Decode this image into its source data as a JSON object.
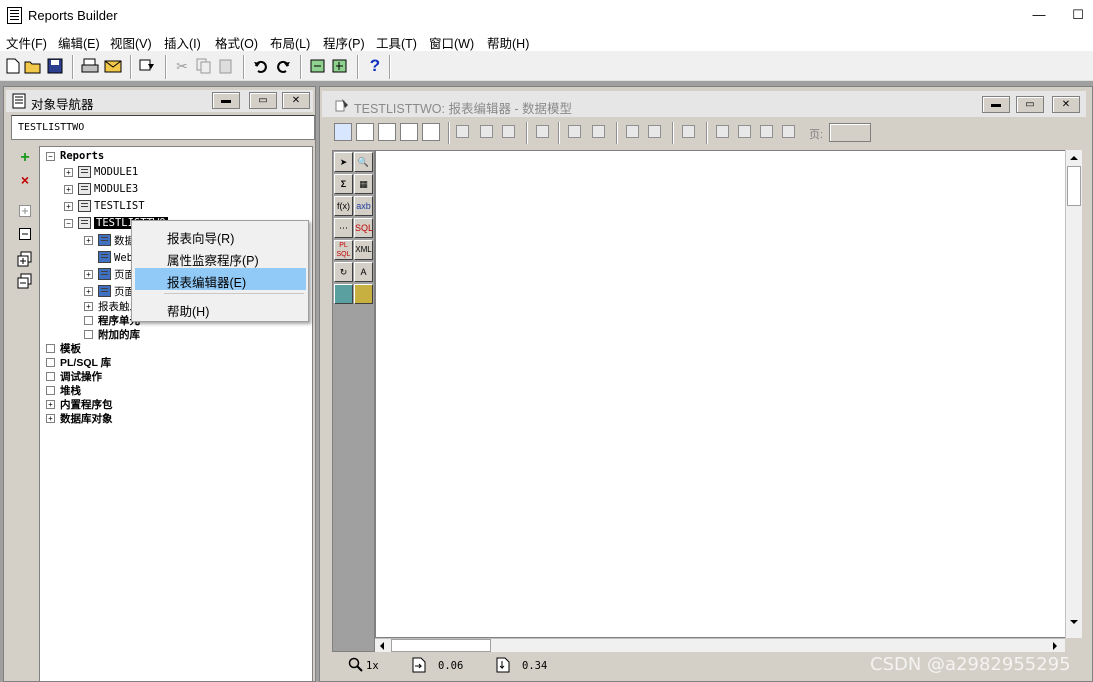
{
  "window": {
    "title": "Reports Builder",
    "minimize": "—",
    "maximize": "☐"
  },
  "menu": [
    "文件(F)",
    "编辑(E)",
    "视图(V)",
    "插入(I)",
    "格式(O)",
    "布局(L)",
    "程序(P)",
    "工具(T)",
    "窗口(W)",
    "帮助(H)"
  ],
  "toolbar": {
    "help": "?"
  },
  "navigator": {
    "title": "对象导航器",
    "find_value": "TESTLISTTWO",
    "tools": {
      "create": "+",
      "delete": "×"
    },
    "tree": {
      "reports": "Reports",
      "module1": "MODULE1",
      "module3": "MODULE3",
      "testlist": "TESTLIST",
      "testlisttwo": "TESTLISTTWO",
      "child_data": "数据模型",
      "child_web": "Web 源",
      "child_layout": "页面布局",
      "child_param": "页面参数",
      "child_triggers": "报表触发器",
      "child_units": "程序单元",
      "child_libs": "附加的库",
      "templates": "模板",
      "plsql": "PL/SQL 库",
      "debug": "调试操作",
      "stack": "堆栈",
      "builtin": "内置程序包",
      "dbobjects": "数据库对象"
    }
  },
  "context_menu": {
    "items": [
      "报表向导(R)",
      "属性监察程序(P)",
      "报表编辑器(E)",
      "帮助(H)"
    ],
    "highlighted": "报表编辑器(E)"
  },
  "editor": {
    "title": "TESTLISTTWO: 报表编辑器 - 数据模型",
    "page_label": "页:",
    "page_value": "",
    "status": {
      "zoom": "1x",
      "x": "0.06",
      "y": "0.34"
    },
    "palette": {
      "formula": "f(x)",
      "summary": "Σ",
      "placeholder": "axb",
      "sql": "SQL",
      "plsql": "PL SQL",
      "xml": "XML"
    }
  },
  "watermark": "CSDN @a2982955295",
  "colors": {
    "highlight": "#91c9f7",
    "selected": "#000000"
  }
}
